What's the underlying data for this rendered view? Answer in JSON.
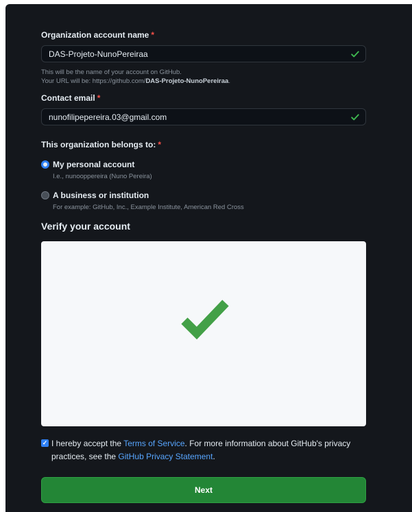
{
  "org_name": {
    "label": "Organization account name",
    "required_marker": "*",
    "value": "DAS-Projeto-NunoPereiraa",
    "hint_line1": "This will be the name of your account on GitHub.",
    "hint_line2_prefix": "Your URL will be: https://github.com/",
    "hint_line2_name": "DAS-Projeto-NunoPereiraa",
    "hint_line2_suffix": ".",
    "valid_icon": "check-icon"
  },
  "contact_email": {
    "label": "Contact email",
    "required_marker": "*",
    "value": "nunofilipepereira.03@gmail.com",
    "valid_icon": "check-icon"
  },
  "belongs_to": {
    "label": "This organization belongs to:",
    "required_marker": "*",
    "options": [
      {
        "title": "My personal account",
        "subtitle": "I.e., nunooppereira (Nuno Pereira)",
        "selected": true
      },
      {
        "title": "A business or institution",
        "subtitle": "For example: GitHub, Inc., Example Institute, American Red Cross",
        "selected": false
      }
    ]
  },
  "verify": {
    "title": "Verify your account",
    "status_icon": "big-check-icon"
  },
  "terms": {
    "checked": true,
    "text_before": "I hereby accept the ",
    "tos_link": "Terms of Service",
    "text_middle": ". For more information about GitHub's privacy practices, see the ",
    "privacy_link": "GitHub Privacy Statement",
    "text_after": "."
  },
  "next_button": {
    "label": "Next"
  },
  "colors": {
    "background": "#14171c",
    "accent_blue": "#2f81f7",
    "link": "#58a6ff",
    "success_green": "#3fb950",
    "button_green": "#238636",
    "required_red": "#f85149"
  }
}
